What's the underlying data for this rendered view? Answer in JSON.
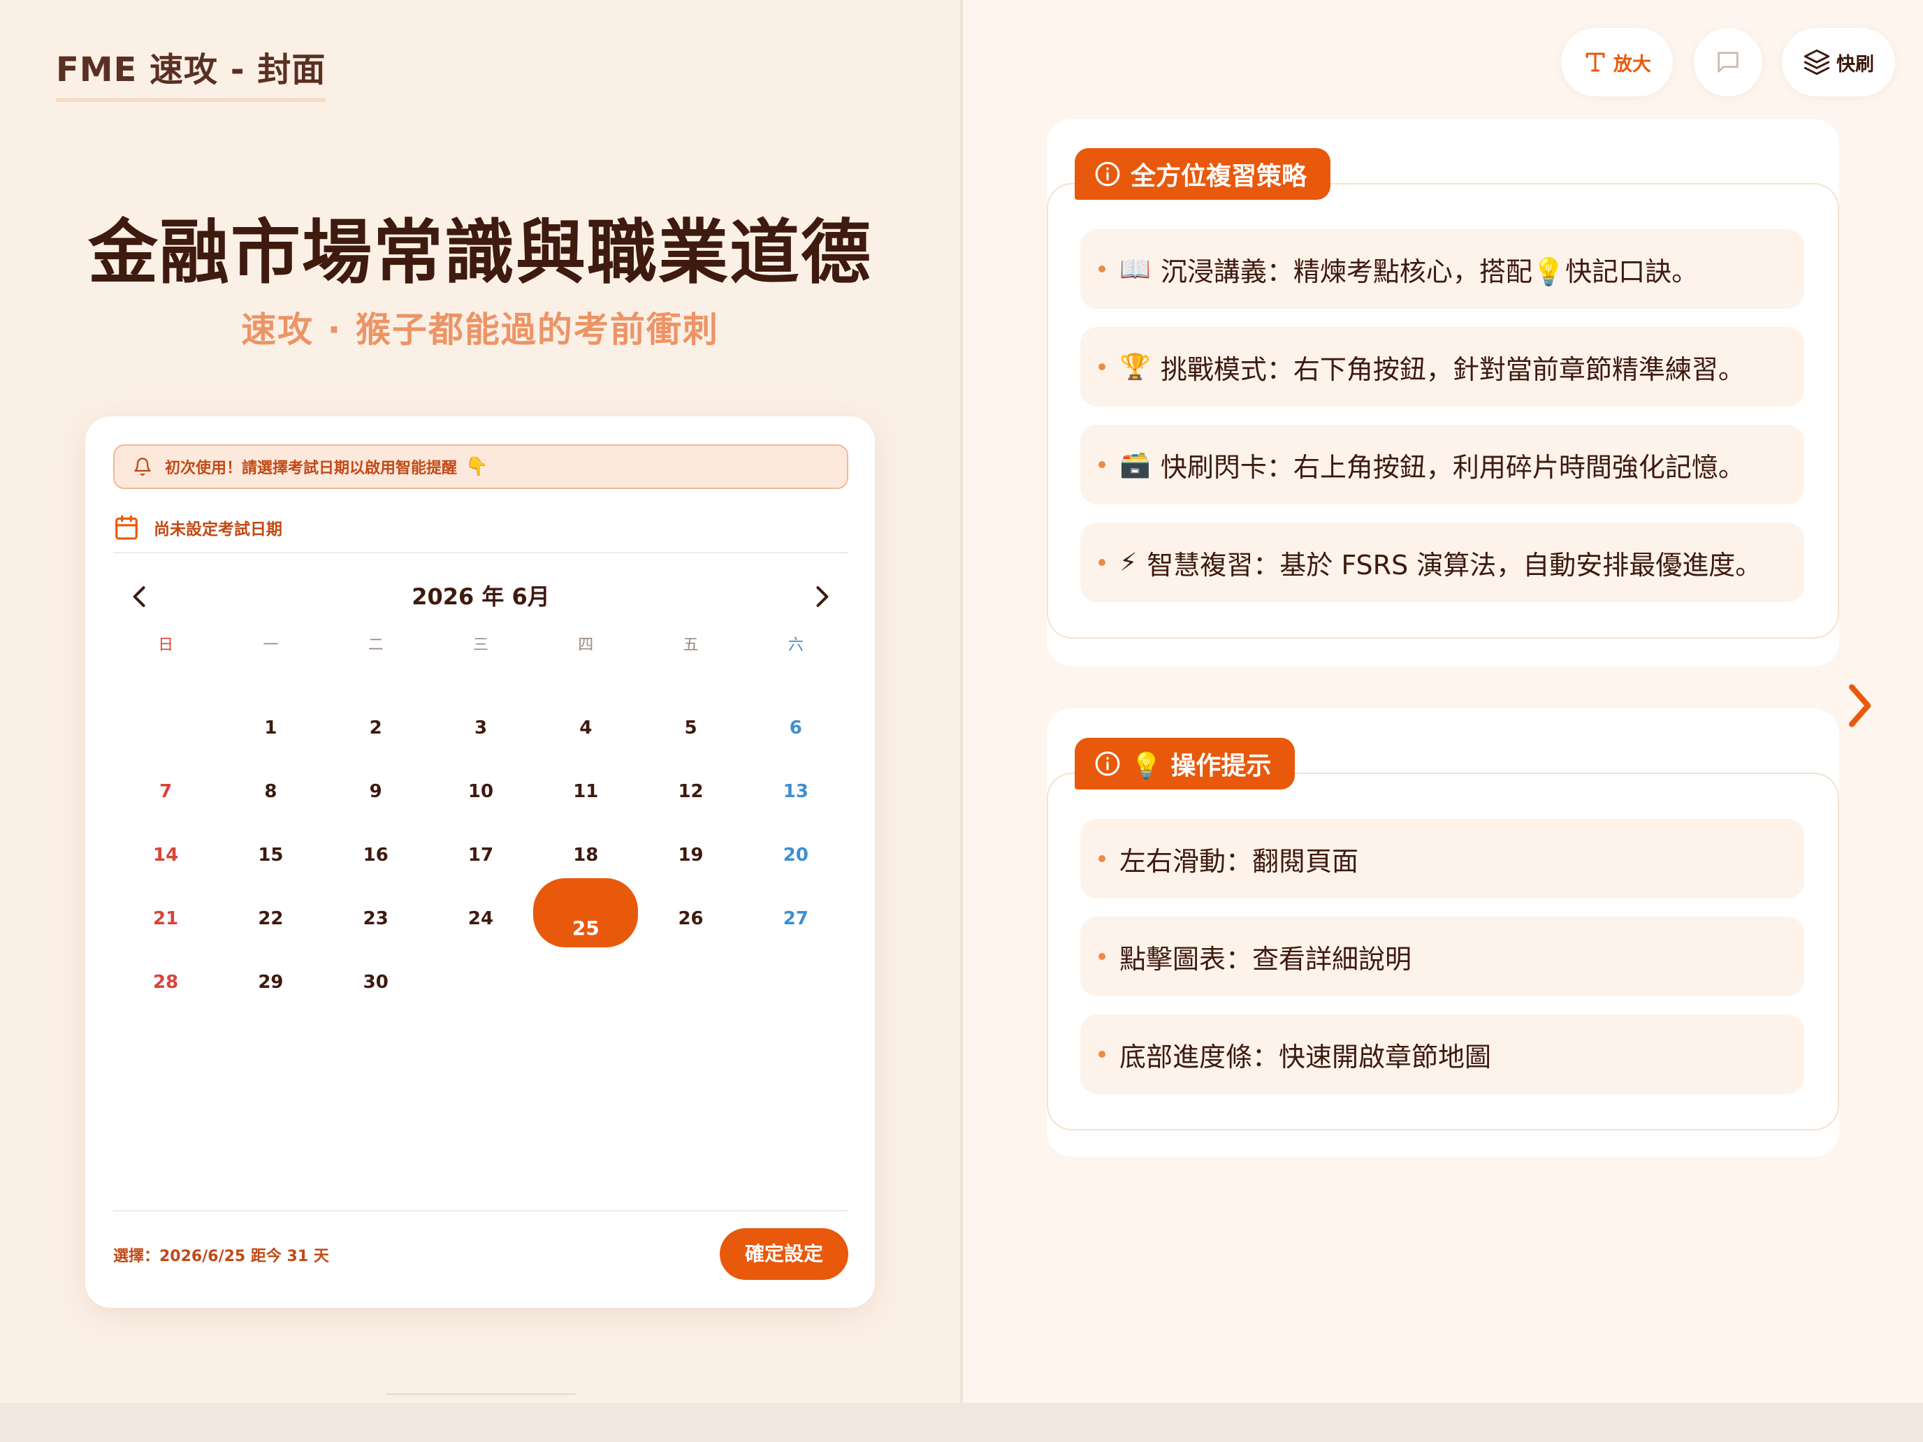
{
  "header": {
    "doc_title": "FME 速攻 - 封面"
  },
  "cover": {
    "main_title": "金融市場常識與職業道德",
    "subtitle": "速攻 · 猴子都能過的考前衝刺"
  },
  "calendar": {
    "alert_text": "初次使用！請選擇考試日期以啟用智能提醒",
    "alert_emoji": "👇",
    "date_status": "尚未設定考試日期",
    "month_label": "2026 年 6月",
    "weekdays": [
      "日",
      "一",
      "二",
      "三",
      "四",
      "五",
      "六"
    ],
    "weeks": [
      [
        "",
        "1",
        "2",
        "3",
        "4",
        "5",
        "6"
      ],
      [
        "7",
        "8",
        "9",
        "10",
        "11",
        "12",
        "13"
      ],
      [
        "14",
        "15",
        "16",
        "17",
        "18",
        "19",
        "20"
      ],
      [
        "21",
        "22",
        "23",
        "24",
        "25",
        "26",
        "27"
      ],
      [
        "28",
        "29",
        "30",
        "",
        "",
        "",
        ""
      ]
    ],
    "selected_day": "25",
    "selection_text": "選擇：2026/6/25  距今 31 天",
    "confirm_label": "確定設定"
  },
  "toolbar": {
    "enlarge_label": "放大",
    "flash_label": "快刷",
    "comment_icon": "comment-icon"
  },
  "strategy": {
    "title": "全方位複習策略",
    "items": [
      {
        "emoji": "📖",
        "text": "沉浸講義：精煉考點核心，搭配💡快記口訣。"
      },
      {
        "emoji": "🏆",
        "text": "挑戰模式：右下角按鈕，針對當前章節精準練習。"
      },
      {
        "emoji": "🗃️",
        "text": "快刷閃卡：右上角按鈕，利用碎片時間強化記憶。"
      },
      {
        "emoji": "⚡",
        "text": "智慧複習：基於 FSRS 演算法，自動安排最優進度。"
      }
    ]
  },
  "tips": {
    "title": "💡 操作提示",
    "items": [
      {
        "text": "左右滑動：翻閱頁面"
      },
      {
        "text": "點擊圖表：查看詳細說明"
      },
      {
        "text": "底部進度條：快速開啟章節地圖"
      }
    ]
  },
  "colors": {
    "accent": "#e8590c",
    "sunday": "#d8443a",
    "saturday": "#3e8fd0",
    "background": "#fbf0e6"
  }
}
